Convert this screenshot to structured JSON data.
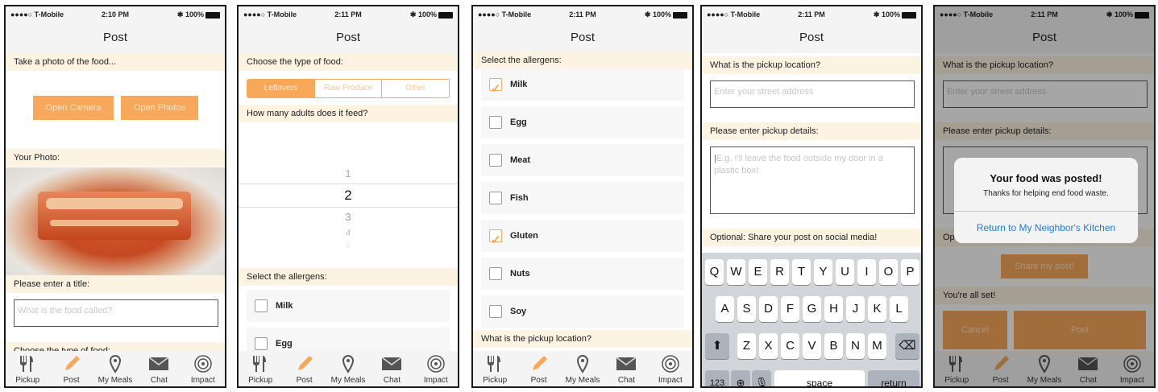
{
  "status": {
    "carrier": "●●●●○ T-Mobile",
    "battery": "100%",
    "times": [
      "2:10 PM",
      "2:11 PM",
      "2:11 PM",
      "2:11 PM",
      "2:11 PM"
    ]
  },
  "nav_title": "Post",
  "tabs": [
    {
      "label": "Pickup",
      "icon": "fork-knife-icon"
    },
    {
      "label": "Post",
      "icon": "pencil-icon"
    },
    {
      "label": "My Meals",
      "icon": "map-pin-icon"
    },
    {
      "label": "Chat",
      "icon": "envelope-icon"
    },
    {
      "label": "Impact",
      "icon": "target-icon"
    }
  ],
  "colors": {
    "accent": "#f7a85b",
    "section_bg": "#fcf3e2",
    "link": "#1a7bf2"
  },
  "screen1": {
    "take_photo": "Take a photo of the food...",
    "open_camera": "Open Camera",
    "open_photos": "Open Photos",
    "your_photo": "Your Photo:",
    "enter_title": "Please enter a title:",
    "title_placeholder": "What is the food called?",
    "choose_type": "Choose the type of food:"
  },
  "screen2": {
    "choose_type": "Choose the type of food:",
    "segments": [
      "Leftovers",
      "Raw Produce",
      "Other"
    ],
    "how_many": "How many adults does it feed?",
    "picker": [
      "1",
      "2",
      "3",
      "4",
      "5"
    ],
    "select_allergens": "Select the allergens:",
    "allergens": [
      "Milk",
      "Egg"
    ]
  },
  "screen3": {
    "select_allergens": "Select the allergens:",
    "allergens": [
      {
        "label": "Milk",
        "checked": true
      },
      {
        "label": "Egg",
        "checked": false
      },
      {
        "label": "Meat",
        "checked": false
      },
      {
        "label": "Fish",
        "checked": false
      },
      {
        "label": "Gluten",
        "checked": true
      },
      {
        "label": "Nuts",
        "checked": false
      },
      {
        "label": "Soy",
        "checked": false
      }
    ],
    "pickup_location": "What is the pickup location?"
  },
  "screen4": {
    "pickup_location": "What is the pickup location?",
    "address_placeholder": "Enter your street address",
    "pickup_details": "Please enter pickup details:",
    "details_placeholder": "E.g. I'll leave the food outside my door in a plastic box!",
    "share": "Optional: Share your post on social media!",
    "keyboard": {
      "row1": [
        "Q",
        "W",
        "E",
        "R",
        "T",
        "Y",
        "U",
        "I",
        "O",
        "P"
      ],
      "row2": [
        "A",
        "S",
        "D",
        "F",
        "G",
        "H",
        "J",
        "K",
        "L"
      ],
      "row3": [
        "Z",
        "X",
        "C",
        "V",
        "B",
        "N",
        "M"
      ],
      "num": "123",
      "space": "space",
      "return": "return"
    }
  },
  "screen5": {
    "pickup_location": "What is the pickup location?",
    "address_placeholder": "Enter your street address",
    "pickup_details": "Please enter pickup details:",
    "share_label": "Op",
    "share_button": "Share my post!",
    "all_set": "You're all set!",
    "cancel": "Cancel",
    "post": "Post",
    "alert_title": "Your food was posted!",
    "alert_message": "Thanks for helping end food waste.",
    "alert_button": "Return to My Neighbor's Kitchen"
  }
}
